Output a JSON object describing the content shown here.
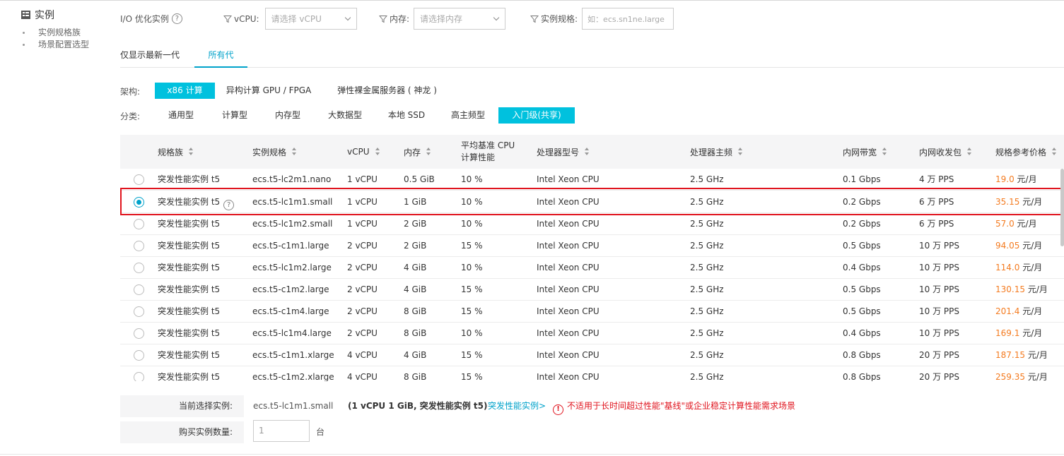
{
  "sidebar": {
    "title": "实例",
    "items": [
      {
        "label": "实例规格族"
      },
      {
        "label": "场景配置选型"
      }
    ]
  },
  "filters": {
    "io_label": "I/O 优化实例",
    "help": "?",
    "vcpu_label": "vCPU:",
    "vcpu_placeholder": "请选择 vCPU",
    "mem_label": "内存:",
    "mem_placeholder": "请选择内存",
    "spec_label": "实例规格:",
    "spec_placeholder": "如：ecs.sn1ne.large"
  },
  "gen_tabs": [
    {
      "label": "仅显示最新一代",
      "active": false
    },
    {
      "label": "所有代",
      "active": true
    }
  ],
  "arch": {
    "label": "架构:",
    "options": [
      {
        "label": "x86 计算",
        "active": true
      },
      {
        "label": "异构计算 GPU / FPGA",
        "active": false
      },
      {
        "label": "弹性裸金属服务器 ( 神龙 )",
        "active": false
      }
    ]
  },
  "category": {
    "label": "分类:",
    "options": [
      {
        "label": "通用型",
        "active": false
      },
      {
        "label": "计算型",
        "active": false
      },
      {
        "label": "内存型",
        "active": false
      },
      {
        "label": "大数据型",
        "active": false
      },
      {
        "label": "本地 SSD",
        "active": false
      },
      {
        "label": "高主频型",
        "active": false
      },
      {
        "label": "入门级(共享)",
        "active": true
      }
    ]
  },
  "table": {
    "headers": {
      "family": "规格族",
      "spec": "实例规格",
      "vcpu": "vCPU",
      "mem": "内存",
      "baseline_line1": "平均基准 CPU",
      "baseline_line2": "计算性能",
      "processor": "处理器型号",
      "freq": "处理器主频",
      "bandwidth": "内网带宽",
      "pps": "内网收发包",
      "price": "规格参考价格"
    },
    "price_unit": "元/月",
    "rows": [
      {
        "family": "突发性能实例 t5",
        "spec": "ecs.t5-lc2m1.nano",
        "vcpu": "1 vCPU",
        "mem": "0.5 GiB",
        "baseline": "10 %",
        "processor": "Intel Xeon CPU",
        "freq": "2.5 GHz",
        "bandwidth": "0.1 Gbps",
        "pps": "4 万 PPS",
        "price": "19.0",
        "selected": false
      },
      {
        "family": "突发性能实例 t5",
        "spec": "ecs.t5-lc1m1.small",
        "vcpu": "1 vCPU",
        "mem": "1 GiB",
        "baseline": "10 %",
        "processor": "Intel Xeon CPU",
        "freq": "2.5 GHz",
        "bandwidth": "0.2 Gbps",
        "pps": "6 万 PPS",
        "price": "35.15",
        "selected": true
      },
      {
        "family": "突发性能实例 t5",
        "spec": "ecs.t5-lc1m2.small",
        "vcpu": "1 vCPU",
        "mem": "2 GiB",
        "baseline": "10 %",
        "processor": "Intel Xeon CPU",
        "freq": "2.5 GHz",
        "bandwidth": "0.2 Gbps",
        "pps": "6 万 PPS",
        "price": "57.0",
        "selected": false
      },
      {
        "family": "突发性能实例 t5",
        "spec": "ecs.t5-c1m1.large",
        "vcpu": "2 vCPU",
        "mem": "2 GiB",
        "baseline": "15 %",
        "processor": "Intel Xeon CPU",
        "freq": "2.5 GHz",
        "bandwidth": "0.5 Gbps",
        "pps": "10 万 PPS",
        "price": "94.05",
        "selected": false
      },
      {
        "family": "突发性能实例 t5",
        "spec": "ecs.t5-lc1m2.large",
        "vcpu": "2 vCPU",
        "mem": "4 GiB",
        "baseline": "10 %",
        "processor": "Intel Xeon CPU",
        "freq": "2.5 GHz",
        "bandwidth": "0.4 Gbps",
        "pps": "10 万 PPS",
        "price": "114.0",
        "selected": false
      },
      {
        "family": "突发性能实例 t5",
        "spec": "ecs.t5-c1m2.large",
        "vcpu": "2 vCPU",
        "mem": "4 GiB",
        "baseline": "15 %",
        "processor": "Intel Xeon CPU",
        "freq": "2.5 GHz",
        "bandwidth": "0.5 Gbps",
        "pps": "10 万 PPS",
        "price": "130.15",
        "selected": false
      },
      {
        "family": "突发性能实例 t5",
        "spec": "ecs.t5-c1m4.large",
        "vcpu": "2 vCPU",
        "mem": "8 GiB",
        "baseline": "15 %",
        "processor": "Intel Xeon CPU",
        "freq": "2.5 GHz",
        "bandwidth": "0.5 Gbps",
        "pps": "10 万 PPS",
        "price": "201.4",
        "selected": false
      },
      {
        "family": "突发性能实例 t5",
        "spec": "ecs.t5-lc1m4.large",
        "vcpu": "2 vCPU",
        "mem": "8 GiB",
        "baseline": "10 %",
        "processor": "Intel Xeon CPU",
        "freq": "2.5 GHz",
        "bandwidth": "0.4 Gbps",
        "pps": "10 万 PPS",
        "price": "169.1",
        "selected": false
      },
      {
        "family": "突发性能实例 t5",
        "spec": "ecs.t5-c1m1.xlarge",
        "vcpu": "4 vCPU",
        "mem": "4 GiB",
        "baseline": "15 %",
        "processor": "Intel Xeon CPU",
        "freq": "2.5 GHz",
        "bandwidth": "0.8 Gbps",
        "pps": "20 万 PPS",
        "price": "187.15",
        "selected": false
      },
      {
        "family": "突发性能实例 t5",
        "spec": "ecs.t5-c1m2.xlarge",
        "vcpu": "4 vCPU",
        "mem": "8 GiB",
        "baseline": "15 %",
        "processor": "Intel Xeon CPU",
        "freq": "2.5 GHz",
        "bandwidth": "0.8 Gbps",
        "pps": "20 万 PPS",
        "price": "259.35",
        "selected": false
      }
    ]
  },
  "summary": {
    "current_label": "当前选择实例:",
    "current_spec": "ecs.t5-lc1m1.small",
    "current_desc": "(1 vCPU 1 GiB, 突发性能实例 t5)",
    "link": "突发性能实例>",
    "warn_icon": "!",
    "warning": "不适用于长时间超过性能\"基线\"或企业稳定计算性能需求场景",
    "qty_label": "购买实例数量:",
    "qty_value": "1",
    "qty_unit": "台"
  },
  "colors": {
    "accent": "#00c1de",
    "link": "#00a2ca",
    "price": "#f47b20",
    "warning": "#e0141e"
  }
}
